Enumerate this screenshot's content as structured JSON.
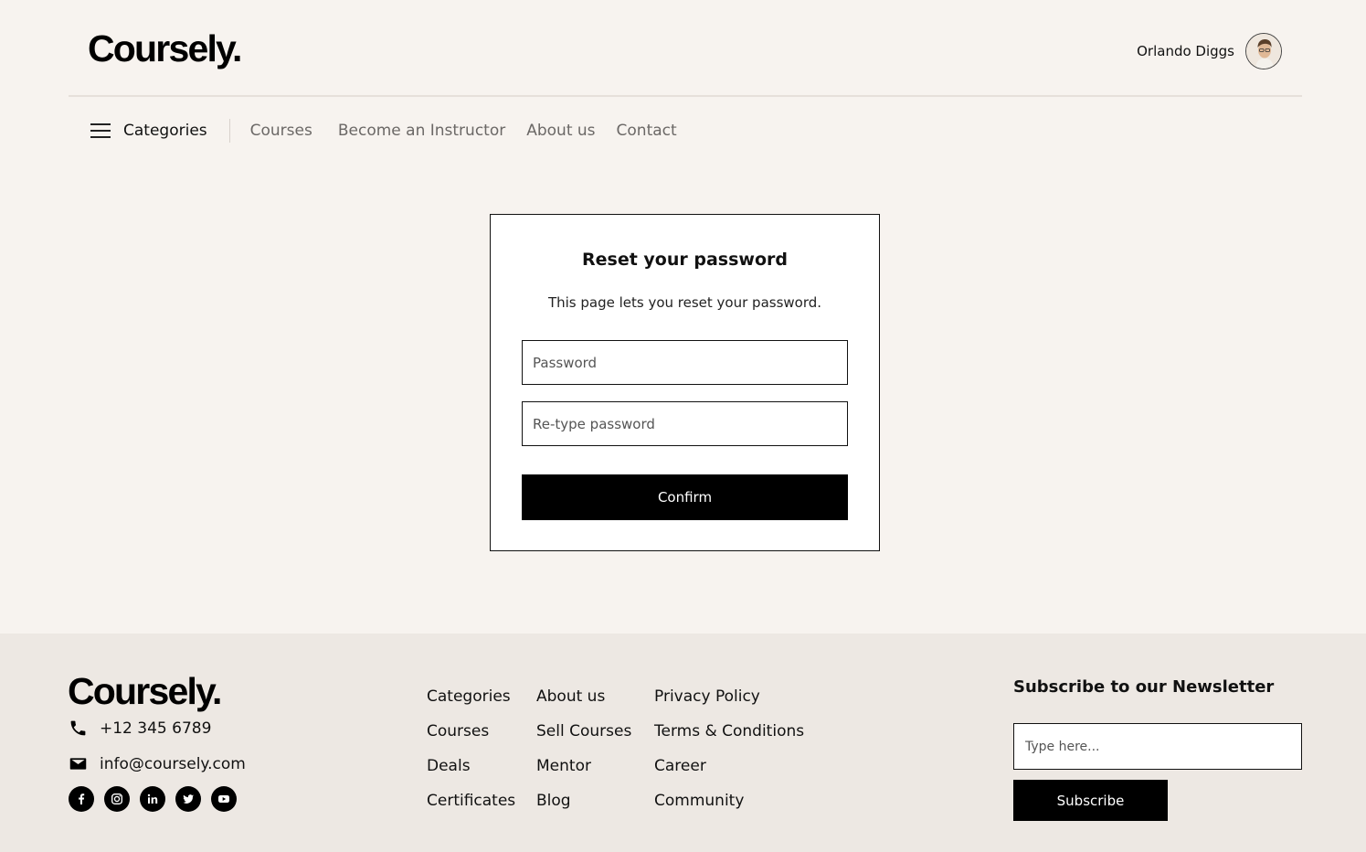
{
  "header": {
    "logo": "Coursely.",
    "user_name": "Orlando Diggs"
  },
  "nav": {
    "categories_label": "Categories",
    "links": [
      "Courses",
      "Become an Instructor",
      "About us",
      "Contact"
    ]
  },
  "reset_card": {
    "title": "Reset your password",
    "description": "This page lets you reset your password.",
    "password_placeholder": "Password",
    "retype_placeholder": "Re-type password",
    "confirm_label": "Confirm"
  },
  "footer": {
    "logo": "Coursely.",
    "phone": "+12 345 6789",
    "email": "info@coursely.com",
    "socials": [
      "facebook-icon",
      "instagram-icon",
      "linkedin-icon",
      "twitter-icon",
      "youtube-icon"
    ],
    "col1": [
      "Categories",
      "Courses",
      "Deals",
      "Certificates"
    ],
    "col2": [
      "About us",
      "Sell Courses",
      "Mentor",
      "Blog"
    ],
    "col3": [
      "Privacy Policy",
      "Terms & Conditions",
      "Career",
      "Community"
    ],
    "newsletter": {
      "title": "Subscribe to our Newsletter",
      "placeholder": "Type here...",
      "button_label": "Subscribe"
    }
  },
  "colors": {
    "page_bg": "#f7f3ef",
    "footer_bg": "#ede8e3",
    "primary": "#000000"
  }
}
